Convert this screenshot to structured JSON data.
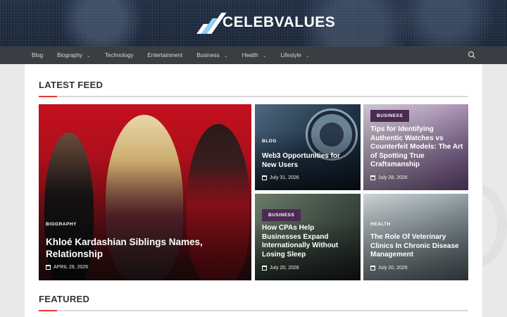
{
  "brand": {
    "logo_text": "CELEBVALUES"
  },
  "nav": {
    "items": [
      {
        "label": "Blog",
        "dropdown": false
      },
      {
        "label": "Biography",
        "dropdown": true
      },
      {
        "label": "Technology",
        "dropdown": false
      },
      {
        "label": "Entertainment",
        "dropdown": false
      },
      {
        "label": "Business",
        "dropdown": true
      },
      {
        "label": "Health",
        "dropdown": true
      },
      {
        "label": "Lifestyle",
        "dropdown": true
      }
    ],
    "search_icon": "search-icon"
  },
  "latest_feed": {
    "title": "LATEST FEED",
    "featured": {
      "category": "BIOGRAPHY",
      "title": "Khloé Kardashian Siblings Names, Relationship",
      "date": "APRIL 29, 2026"
    },
    "posts": [
      {
        "category": "BLOG",
        "title": "Web3 Opportunities for New Users",
        "date": "July 31, 2026"
      },
      {
        "category": "BUSINESS",
        "title": "Tips for Identifying Authentic Watches vs Counterfeit Models: The Art of Spotting True Craftsmanship",
        "date": "July 28, 2026"
      },
      {
        "category": "BUSINESS",
        "title": "How CPAs Help Businesses Expand Internationally Without Losing Sleep",
        "date": "July 20, 2026"
      },
      {
        "category": "HEALTH",
        "title": "The Role Of Veterinary Clinics In Chronic Disease Management",
        "date": "July 20, 2026"
      }
    ]
  },
  "featured_section": {
    "title": "FEATURED"
  },
  "colors": {
    "accent": "#e53935",
    "badge": "#4b2a52",
    "navbar": "#3a3d42",
    "header": "#1f2d43"
  }
}
